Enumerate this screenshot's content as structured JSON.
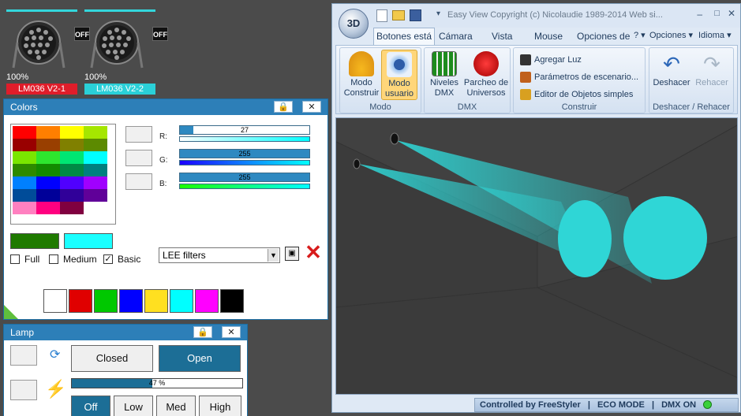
{
  "fixtures": [
    {
      "percent": "100%",
      "name": "LM036 V2-1",
      "name_color": "#e01d2a",
      "off_label": "OFF"
    },
    {
      "percent": "100%",
      "name": "LM036 V2-2",
      "name_color": "#2ad0d8",
      "off_label": "OFF"
    }
  ],
  "colors_panel": {
    "title": "Colors",
    "palette": [
      "#ff0000",
      "#ff7f00",
      "#ffff00",
      "#a5e600",
      "#990000",
      "#993f00",
      "#808000",
      "#5c8a00",
      "#7ae600",
      "#2ee62e",
      "#00e673",
      "#00ffff",
      "#2d8a00",
      "#138a00",
      "#008a45",
      "#008080",
      "#0080ff",
      "#0000ff",
      "#5000ff",
      "#a000ff",
      "#004c99",
      "#000099",
      "#300099",
      "#600099",
      "#ff80c0",
      "#ff0080",
      "#800040",
      "#ffffff"
    ],
    "channels": [
      {
        "label": "R:",
        "value": "27",
        "fraction": 0.106,
        "gradient": "#00ffff"
      },
      {
        "label": "G:",
        "value": "255",
        "fraction": 1.0,
        "gradient": "#0000ff"
      },
      {
        "label": "B:",
        "value": "255",
        "fraction": 1.0,
        "gradient": "#00ff00"
      }
    ],
    "current_color": "#1f7a00",
    "target_color": "#1bffff",
    "checkboxes": [
      {
        "label": "Full",
        "checked": false
      },
      {
        "label": "Medium",
        "checked": false
      },
      {
        "label": "Basic",
        "checked": true
      }
    ],
    "filter_select": "LEE filters",
    "quick_colors": [
      "#ffffff",
      "#e00000",
      "#00c800",
      "#0000ff",
      "#ffe020",
      "#00ffff",
      "#ff00ff",
      "#000000"
    ]
  },
  "lamp_panel": {
    "title": "Lamp",
    "closed_label": "Closed",
    "open_label": "Open",
    "progress": "47 %",
    "progress_value": 0.47,
    "modes": [
      "Off",
      "Low",
      "Med",
      "High"
    ]
  },
  "main_window": {
    "orb_label": "3D",
    "title": "Easy View   Copyright (c) Nicolaudie 1989-2014   Web si...",
    "tabs": [
      "Botones está",
      "Cámara",
      "Vista",
      "Mouse",
      "Opciones de",
      "?",
      "Opciones",
      "Idioma"
    ],
    "groups": {
      "modo": {
        "label": "Modo",
        "buttons": [
          {
            "label": "Modo Construir"
          },
          {
            "label": "Modo usuario"
          }
        ]
      },
      "dmx": {
        "label": "DMX",
        "buttons": [
          {
            "label": "Niveles DMX"
          },
          {
            "label": "Parcheo de Universos"
          }
        ]
      },
      "construir": {
        "label": "Construir",
        "items": [
          "Agregar Luz",
          "Parámetros de escenario...",
          "Editor de Objetos simples"
        ]
      },
      "deshacer": {
        "label": "Deshacer / Rehacer",
        "buttons": [
          {
            "label": "Deshacer"
          },
          {
            "label": "Rehacer"
          }
        ]
      }
    },
    "status": {
      "controlled": "Controlled by FreeStyler",
      "eco": "ECO MODE",
      "dmx": "DMX ON",
      "separator": "|"
    },
    "beam_color": "#2fd6d6"
  }
}
